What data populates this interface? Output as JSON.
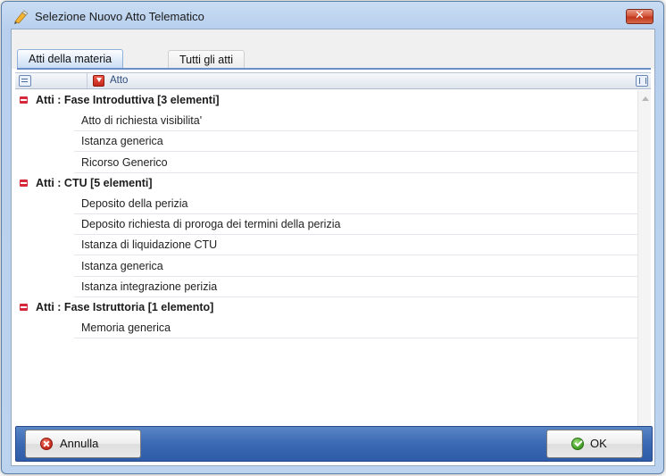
{
  "window": {
    "title": "Selezione Nuovo Atto Telematico",
    "close_label": "✕"
  },
  "tabs": [
    {
      "label": "Atti della materia",
      "active": true
    },
    {
      "label": "Tutti gli atti",
      "active": false
    }
  ],
  "grid": {
    "column_header": "Atto",
    "groups": [
      {
        "label": "Atti : Fase Introduttiva  [3 elementi]",
        "items": [
          "Atto di richiesta visibilita'",
          "Istanza generica",
          "Ricorso Generico"
        ]
      },
      {
        "label": "Atti : CTU  [5 elementi]",
        "items": [
          "Deposito della perizia",
          "Deposito richiesta di proroga dei termini della perizia",
          "Istanza di liquidazione CTU",
          "Istanza generica",
          "Istanza integrazione perizia"
        ]
      },
      {
        "label": "Atti : Fase Istruttoria  [1 elemento]",
        "items": [
          "Memoria generica"
        ]
      }
    ]
  },
  "footer": {
    "cancel_label": "Annulla",
    "ok_label": "OK"
  },
  "icons": {
    "app": "document-pen-icon",
    "group_toggle": "collapse-minus-icon",
    "cancel": "cancel-x-icon",
    "ok": "check-icon"
  },
  "colors": {
    "accent": "#3b69b3",
    "group_toggle": "#d7283a",
    "ok_icon": "#3d9a22",
    "cancel_icon": "#c1281b"
  }
}
